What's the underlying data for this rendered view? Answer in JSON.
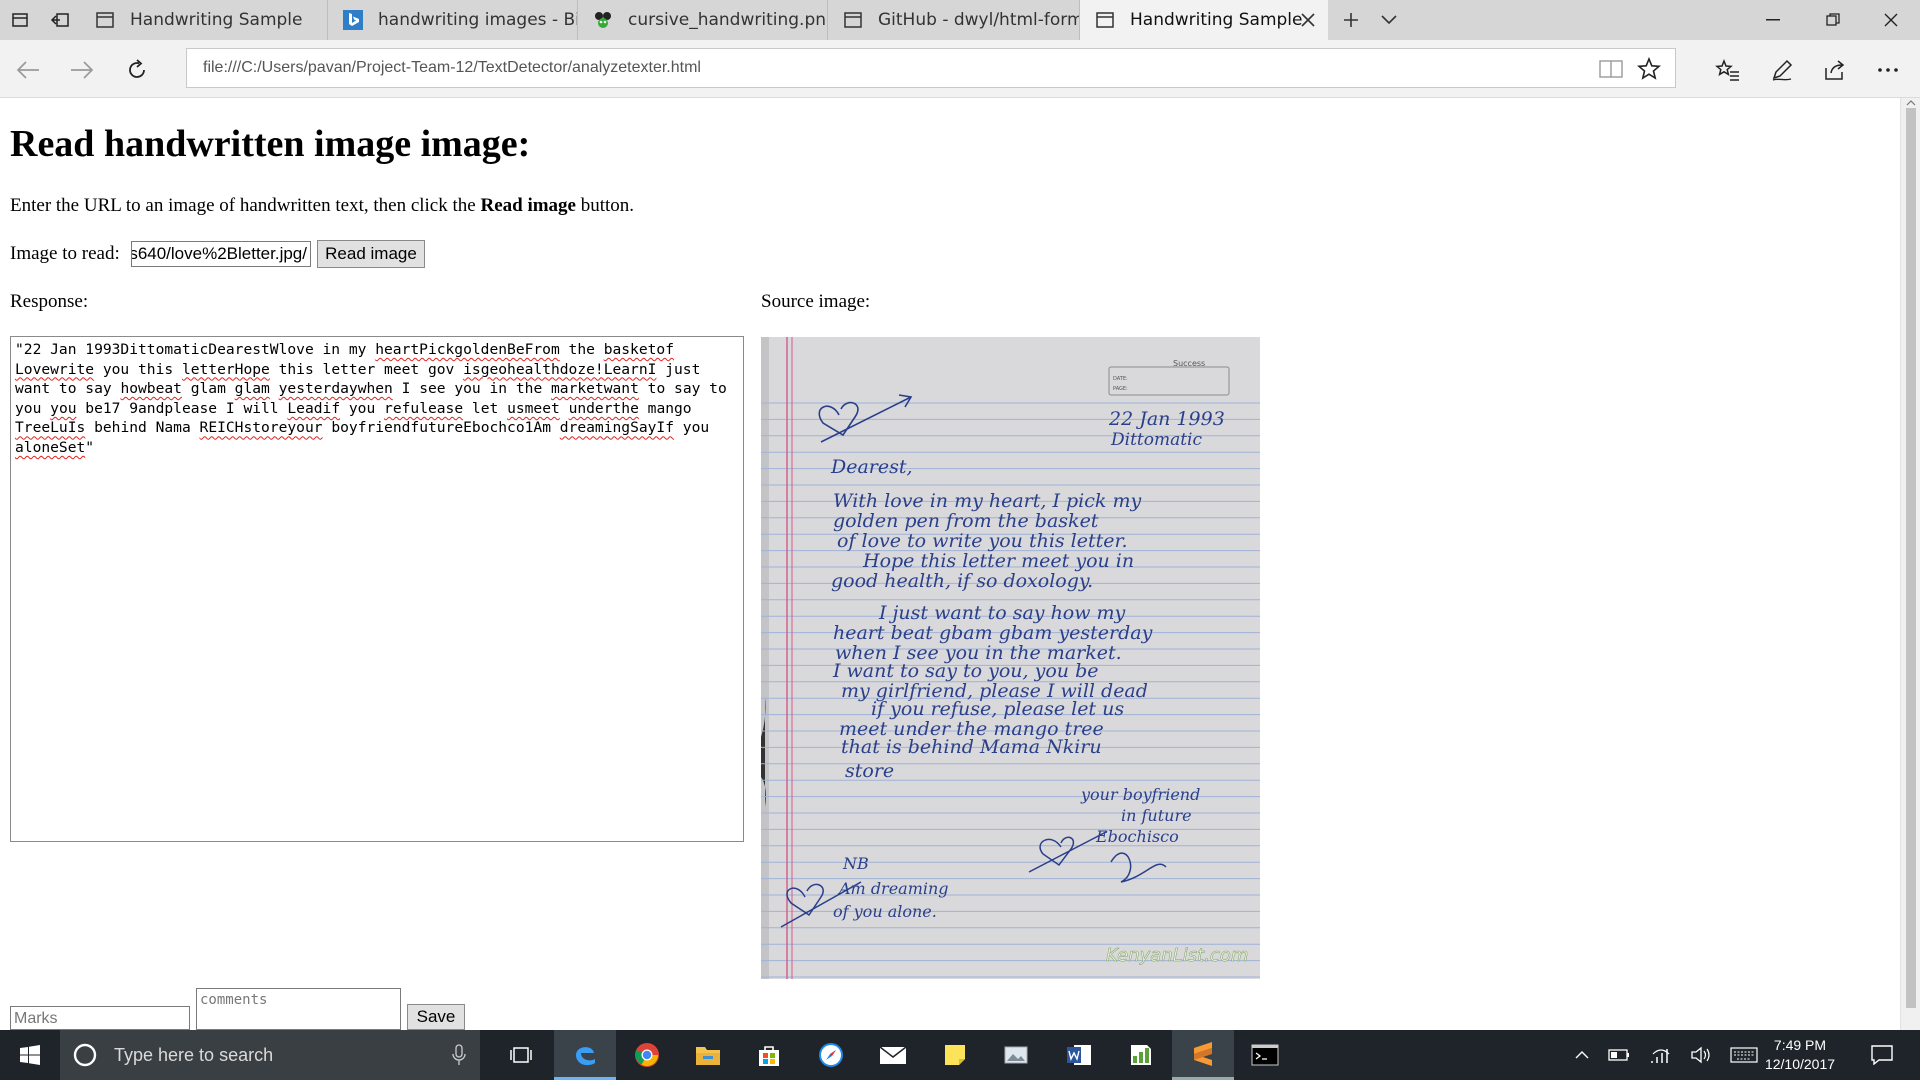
{
  "browser": {
    "tabs": [
      {
        "label": "Handwriting Sample",
        "favicon": "page-icon"
      },
      {
        "label": "handwriting images - Bing i",
        "favicon": "bing-icon"
      },
      {
        "label": "cursive_handwriting.png",
        "favicon": "image-icon"
      },
      {
        "label": "GitHub - dwyl/html-form-se",
        "favicon": "page-icon"
      },
      {
        "label": "Handwriting Sample",
        "favicon": "page-icon",
        "active": true
      }
    ],
    "address": "file:///C:/Users/pavan/Project-Team-12/TextDetector/analyzetexter.html"
  },
  "page": {
    "heading": "Read handwritten image image:",
    "instructions_before": "Enter the URL to an image of handwritten text, then click the ",
    "instructions_bold": "Read image",
    "instructions_after": " button.",
    "image_to_read_label": "Image to read:",
    "image_url_value": "/s640/love%2Bletter.jpg",
    "read_button_label": "Read image",
    "response_label": "Response:",
    "source_image_label": "Source image:",
    "marks_placeholder": "Marks",
    "comments_placeholder": "comments",
    "save_button_label": "Save"
  },
  "response_segments": [
    {
      "t": "\"22 Jan 1993DittomaticDearestWlove in my "
    },
    {
      "t": "heartPickgoldenBeFrom",
      "err": true
    },
    {
      "t": " the "
    },
    {
      "t": "basketof",
      "err": true
    },
    {
      "t": " "
    },
    {
      "t": "Lovewrite",
      "err": true
    },
    {
      "t": " you this "
    },
    {
      "t": "letterHope",
      "err": true
    },
    {
      "t": " this letter meet gov "
    },
    {
      "t": "isgeohealthdoze!LearnI",
      "err": true
    },
    {
      "t": " just want to say "
    },
    {
      "t": "howbeat",
      "err": true
    },
    {
      "t": " glam "
    },
    {
      "t": "glam",
      "err": true
    },
    {
      "t": " "
    },
    {
      "t": "yesterdaywhen",
      "err": true
    },
    {
      "t": " I see you in the "
    },
    {
      "t": "marketwant",
      "err": true
    },
    {
      "t": " to say to you "
    },
    {
      "t": "you",
      "err": true
    },
    {
      "t": " be17 9andplease I will "
    },
    {
      "t": "Leadif",
      "err": true
    },
    {
      "t": " you "
    },
    {
      "t": "refulease",
      "err": true
    },
    {
      "t": " let "
    },
    {
      "t": "usmeet",
      "err": true
    },
    {
      "t": " "
    },
    {
      "t": "underthe",
      "err": true
    },
    {
      "t": " mango "
    },
    {
      "t": "TreeLuIs",
      "err": true
    },
    {
      "t": " behind Nama "
    },
    {
      "t": "REICHstoreyour",
      "err": true
    },
    {
      "t": " boyfriendfutureEbochco1Am "
    },
    {
      "t": "dreamingSayIf",
      "err": true
    },
    {
      "t": " you "
    },
    {
      "t": "aloneSet",
      "err": true
    },
    {
      "t": "\""
    }
  ],
  "letter": {
    "stamp": "Success",
    "stamp_date": "DATE:",
    "stamp_page": "PAGE:",
    "date_line1": "22 Jan 1993",
    "date_line2": "Dittomatic",
    "lines": [
      "Dearest,",
      "With love in my heart, I pick my",
      "golden pen from the basket",
      "of love to write you this letter.",
      "Hope this letter meet you in",
      "good health, if so doxology.",
      "I just want to say how my",
      "heart beat gbam gbam yesterday",
      "when I see you in the market.",
      "I want to say to you, you be",
      "my girlfriend, please I will dead",
      "if you refuse, please let us",
      "meet under the mango tree",
      "that is behind Mama Nkiru",
      "store"
    ],
    "sign1": "your boyfriend",
    "sign2": "in future",
    "sign3": "Ebochisco",
    "nb": "NB",
    "ps1": "Am dreaming",
    "ps2": "of you alone.",
    "watermark": "KenyanList.com"
  },
  "taskbar": {
    "search_placeholder": "Type here to search",
    "time": "7:49 PM",
    "date": "12/10/2017"
  },
  "colors": {
    "tabbar": "#d6d6d6",
    "active_tab": "#f2f2f2",
    "taskbar": "#1e2429",
    "spell_underline": "#e0211c",
    "ink": "#2a3f8a"
  }
}
